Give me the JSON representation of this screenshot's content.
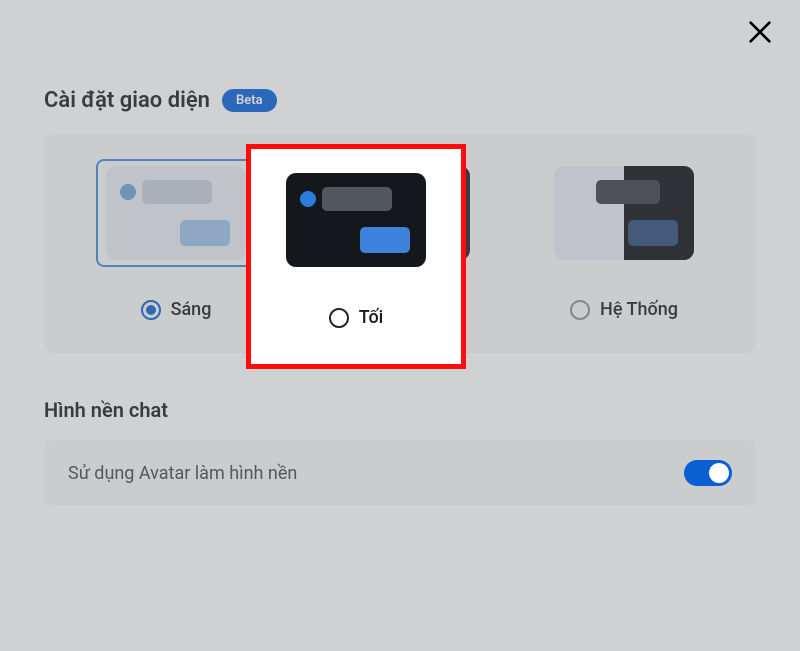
{
  "header": {
    "title": "Cài đặt giao diện",
    "badge": "Beta"
  },
  "themes": {
    "options": [
      {
        "id": "light",
        "label": "Sáng",
        "selected": true
      },
      {
        "id": "dark",
        "label": "Tối",
        "selected": false
      },
      {
        "id": "system",
        "label": "Hệ Thống",
        "selected": false
      }
    ]
  },
  "chatBackground": {
    "title": "Hình nền chat",
    "avatarToggle": {
      "label": "Sử dụng Avatar làm hình nền",
      "enabled": true
    }
  },
  "highlighted": {
    "label": "Tối"
  }
}
